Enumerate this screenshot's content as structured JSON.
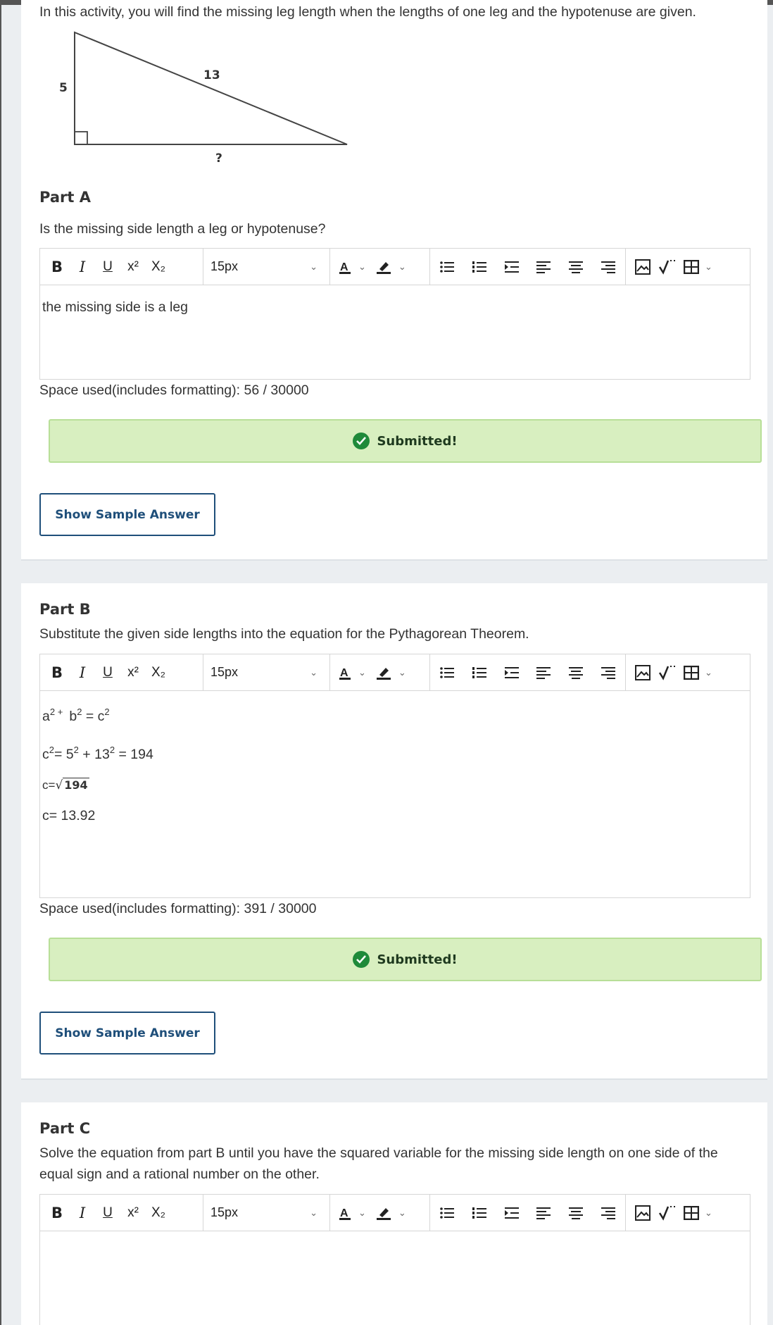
{
  "intro": {
    "text": "In this activity, you will find the missing leg length when the lengths of one leg and the hypotenuse are given.",
    "triangle": {
      "leg_label": "5",
      "hyp_label": "13",
      "missing_label": "?"
    }
  },
  "toolbar": {
    "bold": "B",
    "italic": "I",
    "underline": "U",
    "superscript": "x²",
    "subscript": "X₂",
    "font_size": "15px"
  },
  "part_a": {
    "title": "Part A",
    "prompt": "Is the missing side length a leg or hypotenuse?",
    "answer": "the missing side is a leg",
    "space_used": "Space used(includes formatting): 56 / 30000",
    "status": "Submitted!",
    "sample_button": "Show Sample Answer"
  },
  "part_b": {
    "title": "Part B",
    "prompt": "Substitute the given side lengths into the equation for the Pythagorean Theorem.",
    "line1": {
      "a": "a",
      "plus": " + ",
      "b": "b",
      "eq": " = ",
      "c": "c",
      "exp": "2"
    },
    "line2": {
      "c": "c",
      "exp": "2",
      "eq": "= ",
      "five": "5",
      "plus": " + ",
      "thirteen": "13",
      "result": " = 194"
    },
    "line3": {
      "lhs": "c=",
      "radicand": "194"
    },
    "line4": "c= 13.92",
    "space_used": "Space used(includes formatting): 391 / 30000",
    "status": "Submitted!",
    "sample_button": "Show Sample Answer"
  },
  "part_c": {
    "title": "Part C",
    "prompt": "Solve the equation from part B until you have the squared variable for the missing side length on one side of the equal sign and a rational number on the other."
  },
  "colors": {
    "submitted_bg": "#d8efc0",
    "submitted_border": "#b8df98",
    "check": "#1f8a3a",
    "button_border": "#1f4f7a"
  }
}
